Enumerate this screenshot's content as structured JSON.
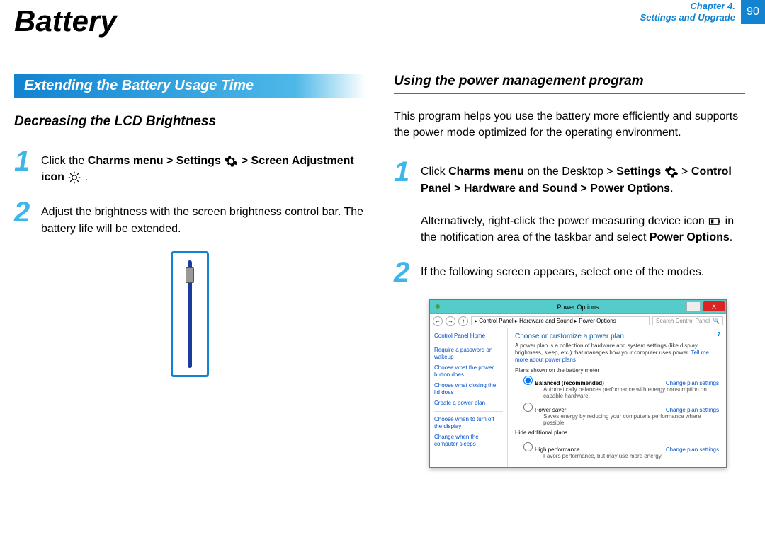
{
  "header": {
    "title": "Battery",
    "chapter_line1": "Chapter 4.",
    "chapter_line2": "Settings and Upgrade",
    "page_num": "90"
  },
  "left": {
    "section_title": "Extending the Battery Usage Time",
    "subheading": "Decreasing the LCD Brightness",
    "steps": [
      {
        "num": "1",
        "parts": {
          "a": "Click the ",
          "b1": "Charms menu > Settings ",
          "b2": " > Screen Adjustment icon ",
          "c": " ."
        }
      },
      {
        "num": "2",
        "text": "Adjust the brightness with the screen brightness control bar. The battery life will be extended."
      }
    ]
  },
  "right": {
    "subheading": "Using the power management program",
    "intro": "This program helps you use the battery more efficiently and supports the power mode optimized for the operating environment.",
    "steps": [
      {
        "num": "1",
        "parts": {
          "a": "Click ",
          "b1": "Charms menu",
          "a2": " on the Desktop > ",
          "b2": "Settings ",
          "a3": " > ",
          "b3": "Control Panel > Hardware and Sound > Power Options",
          "p2a": "Alternatively, right-click the power measuring device icon ",
          "p2b": " in the notification area of the taskbar and select ",
          "b4": "Power Options",
          "p2c": "."
        }
      },
      {
        "num": "2",
        "text": "If the following screen appears, select one of the modes."
      }
    ],
    "shot": {
      "title": "Power Options",
      "close": "X",
      "crumbs": "▸ Control Panel ▸ Hardware and Sound ▸ Power Options",
      "search": "Search Control Panel",
      "side": {
        "home": "Control Panel Home",
        "l1": "Require a password on wakeup",
        "l2": "Choose what the power button does",
        "l3": "Choose what closing the lid does",
        "l4": "Create a power plan",
        "l5": "Choose when to turn off the display",
        "l6": "Change when the computer sleeps"
      },
      "main": {
        "help": "?",
        "h": "Choose or customize a power plan",
        "p": "A power plan is a collection of hardware and system settings (like display brightness, sleep, etc.) that manages how your computer uses power. ",
        "plink": "Tell me more about power plans",
        "sub1": "Plans shown on the battery meter",
        "plan1": "Balanced (recommended)",
        "desc1": "Automatically balances performance with energy consumption on capable hardware.",
        "plan2": "Power saver",
        "desc2": "Saves energy by reducing your computer's performance where possible.",
        "hide": "Hide additional plans",
        "plan3": "High performance",
        "desc3": "Favors performance, but may use more energy.",
        "chg": "Change plan settings"
      }
    }
  }
}
